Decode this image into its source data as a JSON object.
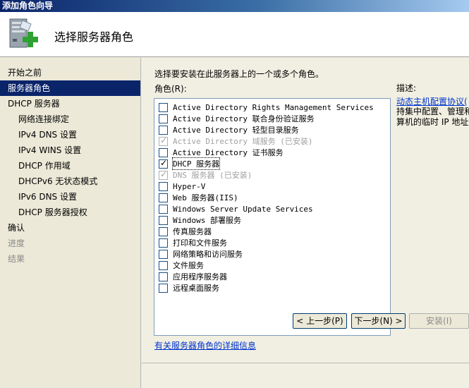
{
  "window": {
    "title": "添加角色向导"
  },
  "header": {
    "title": "选择服务器角色"
  },
  "nav": {
    "items": [
      {
        "label": "开始之前",
        "level": "top",
        "state": "normal"
      },
      {
        "label": "服务器角色",
        "level": "top",
        "state": "active"
      },
      {
        "label": "DHCP 服务器",
        "level": "top",
        "state": "normal"
      },
      {
        "label": "网络连接绑定",
        "level": "sub",
        "state": "normal"
      },
      {
        "label": "IPv4 DNS 设置",
        "level": "sub",
        "state": "normal"
      },
      {
        "label": "IPv4 WINS 设置",
        "level": "sub",
        "state": "normal"
      },
      {
        "label": "DHCP 作用域",
        "level": "sub",
        "state": "normal"
      },
      {
        "label": "DHCPv6 无状态模式",
        "level": "sub",
        "state": "normal"
      },
      {
        "label": "IPv6 DNS 设置",
        "level": "sub",
        "state": "normal"
      },
      {
        "label": "DHCP 服务器授权",
        "level": "sub",
        "state": "normal"
      },
      {
        "label": "确认",
        "level": "top",
        "state": "normal"
      },
      {
        "label": "进度",
        "level": "top",
        "state": "disabled"
      },
      {
        "label": "结果",
        "level": "top",
        "state": "disabled"
      }
    ]
  },
  "main": {
    "instruction": "选择要安装在此服务器上的一个或多个角色。",
    "roles_label": "角色(R):",
    "description_label": "描述:",
    "description_link": "动态主机配置协议(",
    "description_lines": [
      "持集中配置、管理和",
      "算机的临时 IP 地址"
    ],
    "more_info_link": "有关服务器角色的详细信息",
    "roles": [
      {
        "label": "Active Directory Rights Management Services",
        "checked": false,
        "disabled": false,
        "selected": false
      },
      {
        "label": "Active Directory 联合身份验证服务",
        "checked": false,
        "disabled": false,
        "selected": false
      },
      {
        "label": "Active Directory 轻型目录服务",
        "checked": false,
        "disabled": false,
        "selected": false
      },
      {
        "label": "Active Directory 域服务  (已安装)",
        "checked": true,
        "disabled": true,
        "selected": false
      },
      {
        "label": "Active Directory 证书服务",
        "checked": false,
        "disabled": false,
        "selected": false
      },
      {
        "label": "DHCP 服务器",
        "checked": true,
        "disabled": false,
        "selected": true
      },
      {
        "label": "DNS 服务器  (已安装)",
        "checked": true,
        "disabled": true,
        "selected": false
      },
      {
        "label": "Hyper-V",
        "checked": false,
        "disabled": false,
        "selected": false
      },
      {
        "label": "Web 服务器(IIS)",
        "checked": false,
        "disabled": false,
        "selected": false
      },
      {
        "label": "Windows Server Update Services",
        "checked": false,
        "disabled": false,
        "selected": false
      },
      {
        "label": "Windows 部署服务",
        "checked": false,
        "disabled": false,
        "selected": false
      },
      {
        "label": "传真服务器",
        "checked": false,
        "disabled": false,
        "selected": false
      },
      {
        "label": "打印和文件服务",
        "checked": false,
        "disabled": false,
        "selected": false
      },
      {
        "label": "网络策略和访问服务",
        "checked": false,
        "disabled": false,
        "selected": false
      },
      {
        "label": "文件服务",
        "checked": false,
        "disabled": false,
        "selected": false
      },
      {
        "label": "应用程序服务器",
        "checked": false,
        "disabled": false,
        "selected": false
      },
      {
        "label": "远程桌面服务",
        "checked": false,
        "disabled": false,
        "selected": false
      }
    ]
  },
  "buttons": {
    "prev": "< 上一步(P)",
    "next": "下一步(N) >",
    "install": "安装(I)"
  }
}
